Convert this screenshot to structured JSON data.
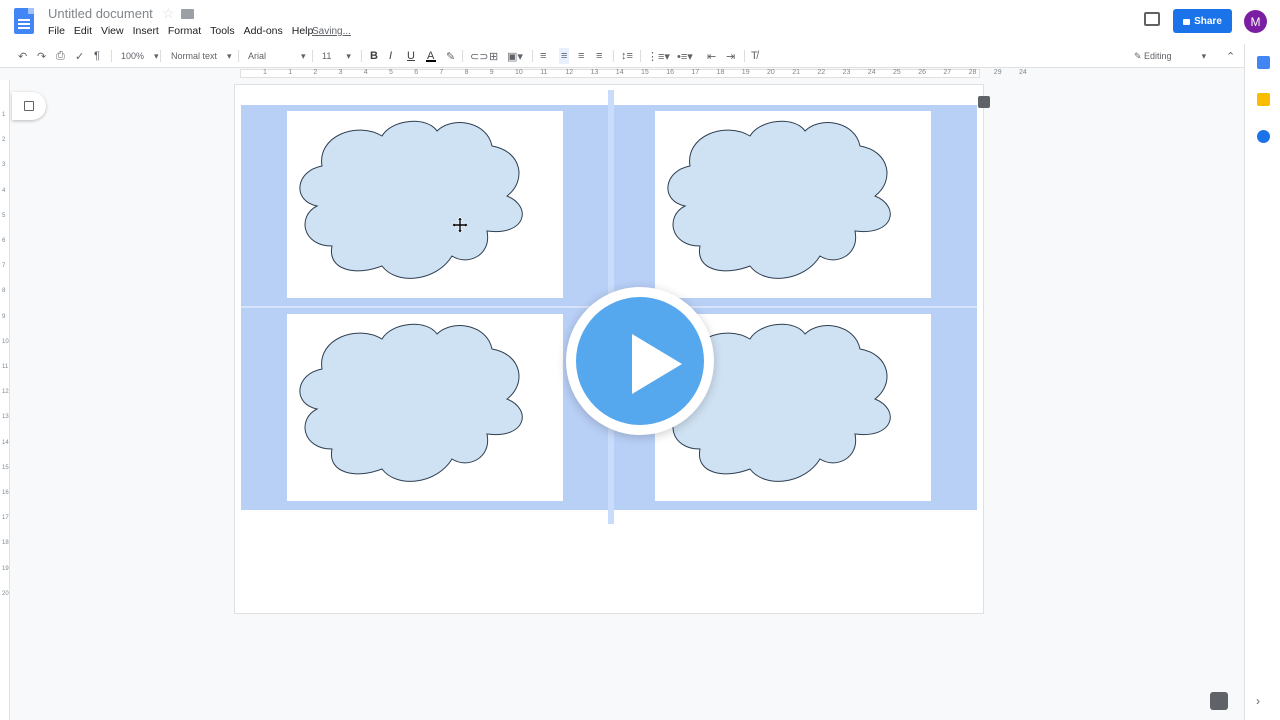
{
  "header": {
    "title": "Untitled document",
    "menu": [
      "File",
      "Edit",
      "View",
      "Insert",
      "Format",
      "Tools",
      "Add-ons",
      "Help"
    ],
    "status": "Saving...",
    "share_label": "Share",
    "avatar_letter": "M"
  },
  "toolbar": {
    "zoom": "100%",
    "style": "Normal text",
    "font": "Arial",
    "size": "11",
    "bold": "B",
    "italic": "I",
    "underline": "U",
    "text_color": "A",
    "mode": "Editing"
  },
  "ruler": {
    "top_ticks": [
      "1",
      "1",
      "2",
      "3",
      "4",
      "5",
      "6",
      "7",
      "8",
      "9",
      "10",
      "11",
      "12",
      "13",
      "14",
      "15",
      "16",
      "17",
      "18",
      "19",
      "20",
      "21",
      "22",
      "23",
      "24",
      "25",
      "26",
      "27",
      "28",
      "29",
      "24"
    ],
    "left_ticks": [
      "1",
      "2",
      "3",
      "4",
      "5",
      "6",
      "7",
      "8",
      "9",
      "10",
      "11",
      "12",
      "13",
      "14",
      "15",
      "16",
      "17",
      "18",
      "19",
      "20"
    ]
  },
  "colors": {
    "brand": "#4285f4",
    "share": "#1a73e8",
    "avatar": "#7b1fa2",
    "selection": "#b8cff6",
    "cloud_fill": "#cfe2f3",
    "play": "#55a7ee"
  },
  "document": {
    "table": {
      "rows": 2,
      "cols": 2,
      "cell_shape": "cloud"
    }
  }
}
